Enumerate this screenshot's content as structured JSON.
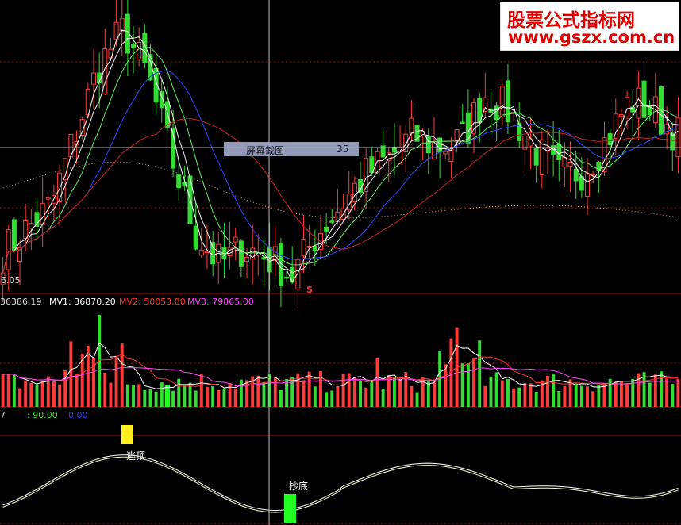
{
  "watermark": {
    "title": "股票公式指标网",
    "url": "www.gszx.com.cn"
  },
  "screenshot_tooltip": {
    "label": "屏幕截图",
    "value": "35"
  },
  "price_panel": {
    "low_label": "6.05",
    "marker": "S"
  },
  "volume_panel": {
    "readout": "36386.19",
    "mv1_label": "MV1: 36870.20",
    "mv2_label": "MV2: 50053.80",
    "mv3_label": "MV3: 79865.00"
  },
  "indicator_panel": {
    "left_digit": "7",
    "upper_level": ": 90.00",
    "lower_level": "0.00",
    "signals": {
      "top": "逃顶",
      "bottom": "抄底"
    }
  },
  "colors": {
    "up": "#ff3b3b",
    "down": "#33dd33",
    "ma_white": "#ffffff",
    "ma_green": "#66ee66",
    "ma_blue": "#3344ff",
    "ma_red": "#d02020",
    "mv2": "#ff3333",
    "mv3": "#ff44ff",
    "signal_top": "#ffee22",
    "signal_bottom": "#22ff22",
    "grid": "#a01010"
  },
  "chart_data": {
    "type": "candlestick",
    "bar_count": 120,
    "price_seed": [
      6.6,
      7.0,
      7.4,
      8.6,
      9.8,
      10.4,
      9.6,
      8.2,
      6.9,
      6.4,
      6.7,
      6.5,
      6.2,
      6.9,
      7.4,
      7.9,
      8.2,
      8.6,
      8.4,
      8.5,
      9.3,
      9.0,
      8.4,
      7.9,
      8.0,
      8.5,
      9.2,
      9.0,
      8.6
    ],
    "indicator_levels": {
      "upper": 90,
      "lower": 0
    },
    "signals": [
      {
        "type": "top",
        "label": "逃顶"
      },
      {
        "type": "bottom",
        "label": "抄底"
      }
    ]
  }
}
